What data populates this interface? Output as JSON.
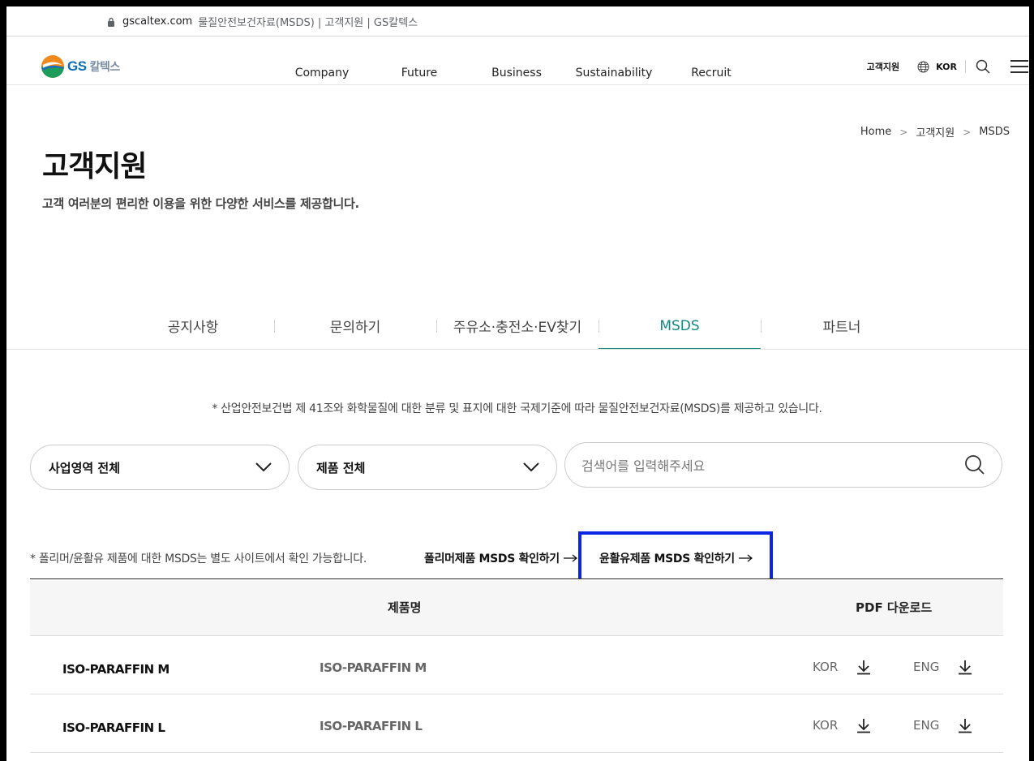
{
  "browser": {
    "domain": "gscaltex.com",
    "page_title": "물질안전보건자료(MSDS) | 고객지원 | GS칼텍스"
  },
  "header": {
    "logo_text": "GS",
    "logo_sub": "칼텍스",
    "nav": [
      "Company",
      "Future",
      "Business",
      "Sustainability",
      "Recruit"
    ],
    "cs_link": "고객지원",
    "lang": "KOR"
  },
  "breadcrumb": {
    "home": "Home",
    "section": "고객지원",
    "current": "MSDS"
  },
  "page": {
    "title": "고객지원",
    "description": "고객 여러분의 편리한 이용을 위한 다양한 서비스를 제공합니다."
  },
  "tabs": [
    {
      "label": "공지사항"
    },
    {
      "label": "문의하기"
    },
    {
      "label": "주유소·충전소·EV찾기"
    },
    {
      "label": "MSDS"
    },
    {
      "label": "파트너"
    }
  ],
  "notice": "* 산업안전보건법 제 41조와 화학물질에 대한 분류 및 표지에 대한 국제기준에 따라 물질안전보건자료(MSDS)를 제공하고 있습니다.",
  "filters": {
    "business_selected": "사업영역 전체",
    "product_selected": "제품 전체",
    "search_placeholder": "검색어를 입력해주세요"
  },
  "external": {
    "note": "* 폴리머/윤활유 제품에 대한 MSDS는 별도 사이트에서 확인 가능합니다.",
    "polymer_link": "폴리머제품 MSDS 확인하기",
    "lube_link": "윤활유제품 MSDS 확인하기"
  },
  "table": {
    "headers": {
      "product": "제품명",
      "pdf": "PDF 다운로드"
    },
    "rows": [
      {
        "name": "ISO-PARAFFIN M",
        "product": "ISO-PARAFFIN M",
        "kor": "KOR",
        "eng": "ENG"
      },
      {
        "name": "ISO-PARAFFIN L",
        "product": "ISO-PARAFFIN L",
        "kor": "KOR",
        "eng": "ENG"
      }
    ]
  },
  "colors": {
    "accent": "#0f8a82",
    "highlight": "#0b24e6"
  }
}
